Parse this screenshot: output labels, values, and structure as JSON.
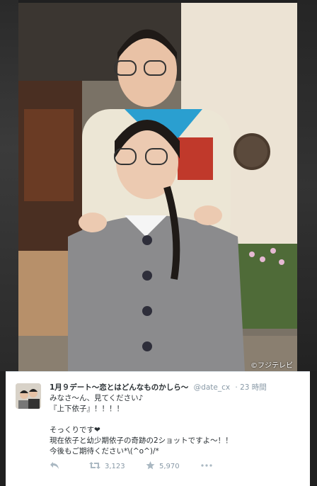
{
  "photo": {
    "copyright": "©フジテレビ"
  },
  "tweet": {
    "display_name": "1月９デート〜恋とはどんなものかしら〜",
    "handle": "@date_cx",
    "time": "· 23 時間",
    "lines": [
      "みなさ〜ん、見てください♪",
      "『上下依子』！！！！",
      "",
      "そっくりです❤",
      "現在依子と幼少期依子の奇跡の2ショットですよ〜！！",
      "今後もご期待ください*\\(^o^)/*"
    ],
    "retweet_count": "3,123",
    "favorite_count": "5,970"
  },
  "colors": {
    "accent": "#8899a6",
    "text": "#292f33"
  },
  "icons": [
    "reply-icon",
    "retweet-icon",
    "favorite-icon",
    "more-icon"
  ]
}
